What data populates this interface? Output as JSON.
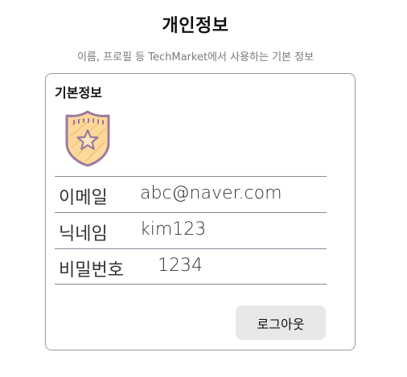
{
  "header": {
    "title": "개인정보",
    "subtitle": "이름, 프로필 등 TechMarket에서 사용하는 기본 정보"
  },
  "card": {
    "title": "기본정보",
    "badge_icon": "police-badge-icon",
    "rows": [
      {
        "label": "이메일",
        "value": "abc@naver.com"
      },
      {
        "label": "닉네임",
        "value": "kim123"
      },
      {
        "label": "비밀번호",
        "value": "1234"
      }
    ],
    "logout_label": "로그아웃"
  },
  "colors": {
    "badge_fill": "#fcd89a",
    "badge_outline": "#9b7aa0",
    "button_bg": "#e8e8e8",
    "divider": "#8a8a9a"
  }
}
